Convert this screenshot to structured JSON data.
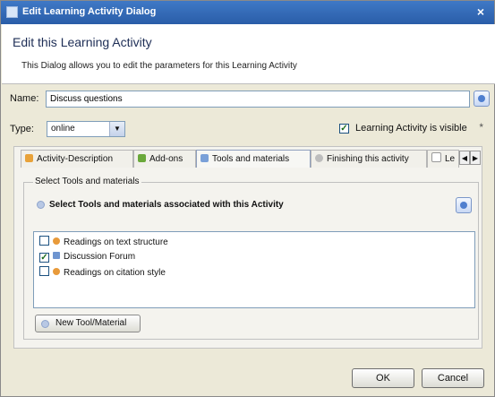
{
  "window": {
    "title": "Edit Learning Activity Dialog",
    "close_label": "×"
  },
  "header": {
    "title": "Edit this Learning Activity",
    "description": "This Dialog allows you to edit the parameters for this Learning Activity"
  },
  "form": {
    "name_label": "Name:",
    "name_value": "Discuss questions",
    "type_label": "Type:",
    "type_value": "online",
    "visible_label": "Learning Activity is visible",
    "visible_checked": true,
    "required_mark": "*"
  },
  "tabs": [
    {
      "label": "Activity-Description",
      "icon": "pencil-icon",
      "color": "#e8a23a"
    },
    {
      "label": "Add-ons",
      "icon": "puzzle-icon",
      "color": "#6aa83a"
    },
    {
      "label": "Tools and materials",
      "icon": "tools-icon",
      "color": "#7aa0d8",
      "active": true
    },
    {
      "label": "Finishing this activity",
      "icon": "finish-icon",
      "color": "#9a9a9a"
    },
    {
      "label": "Le",
      "icon": "check-icon",
      "color": "#9a9a9a"
    }
  ],
  "tab_scroll": {
    "left": "◀",
    "right": "▶"
  },
  "tools_panel": {
    "group_title": "Select Tools and materials",
    "subtitle": "Select Tools and materials associated with this Activity",
    "items": [
      {
        "label": "Readings on text structure",
        "checked": false,
        "icon": "reading-icon",
        "color": "#e89a3a"
      },
      {
        "label": "Discussion Forum",
        "checked": true,
        "icon": "forum-icon",
        "color": "#6f95d0"
      },
      {
        "label": "Readings on citation style",
        "checked": false,
        "icon": "reading-icon",
        "color": "#e89a3a"
      }
    ],
    "new_button": "New Tool/Material"
  },
  "buttons": {
    "ok": "OK",
    "cancel": "Cancel"
  }
}
